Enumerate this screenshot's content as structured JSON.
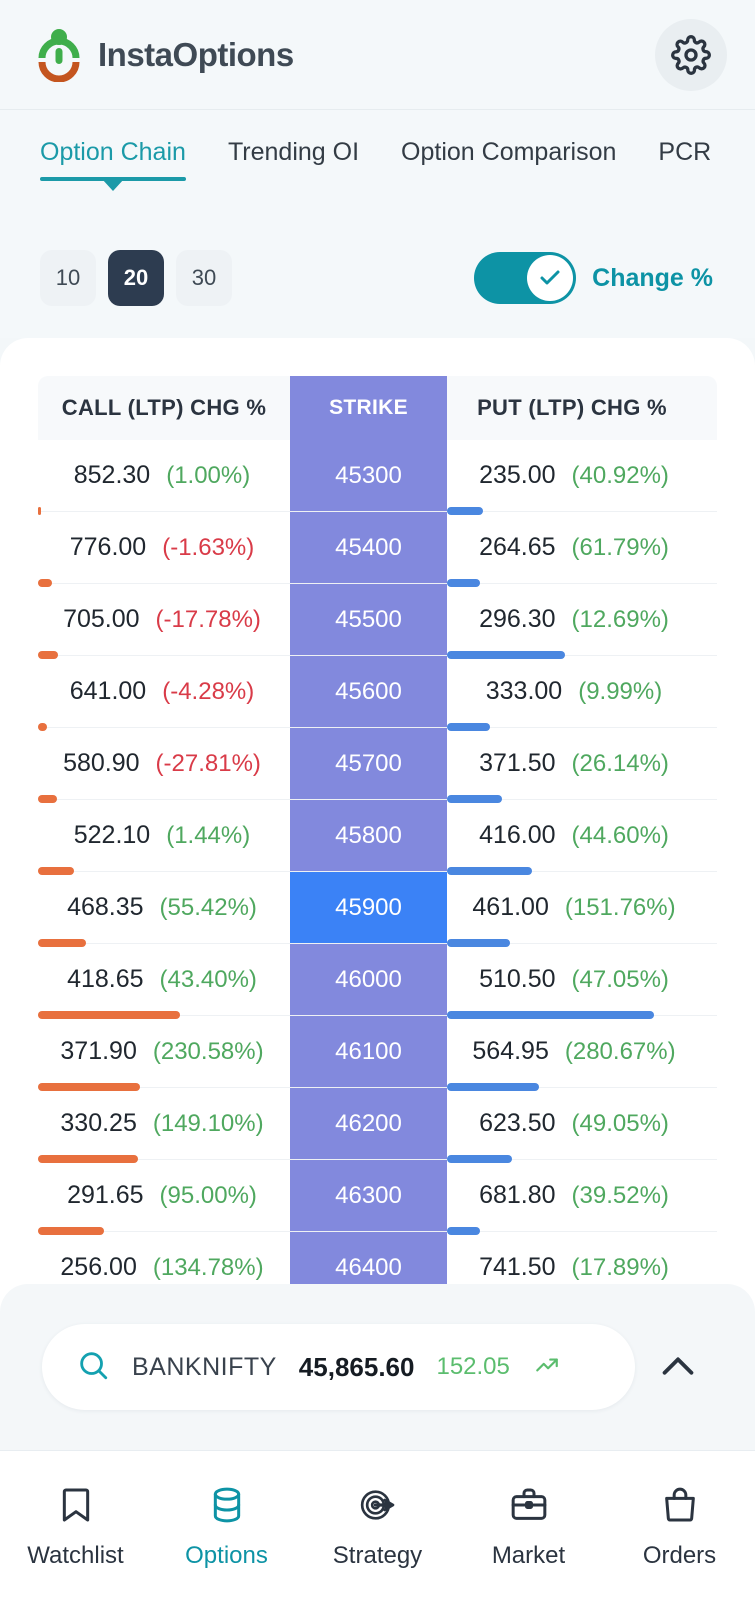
{
  "app": {
    "brand_name": "InstaOptions",
    "logo_icon": "instaoptions-logo",
    "settings_icon": "gear-icon"
  },
  "tabs": [
    {
      "label": "Option Chain",
      "active": true
    },
    {
      "label": "Trending OI",
      "active": false
    },
    {
      "label": "Option Comparison",
      "active": false
    },
    {
      "label": "PCR",
      "active": false
    }
  ],
  "controls": {
    "strike_counts": [
      {
        "label": "10",
        "active": false
      },
      {
        "label": "20",
        "active": true
      },
      {
        "label": "30",
        "active": false
      }
    ],
    "toggle": {
      "label": "Change %",
      "state": "on",
      "check_icon": "check-icon"
    }
  },
  "table": {
    "headers": {
      "call": "CALL (LTP) CHG %",
      "strike": "STRIKE",
      "put": "PUT (LTP) CHG %"
    },
    "rows": [
      {
        "call_ltp": "852.30",
        "call_chg": "(1.00%)",
        "call_dir": "up",
        "call_bar": 3,
        "strike": "45300",
        "atm": false,
        "put_ltp": "235.00",
        "put_chg": "(40.92%)",
        "put_dir": "up",
        "put_bar": 36
      },
      {
        "call_ltp": "776.00",
        "call_chg": "(-1.63%)",
        "call_dir": "down",
        "call_bar": 14,
        "strike": "45400",
        "atm": false,
        "put_ltp": "264.65",
        "put_chg": "(61.79%)",
        "put_dir": "up",
        "put_bar": 33
      },
      {
        "call_ltp": "705.00",
        "call_chg": "(-17.78%)",
        "call_dir": "down",
        "call_bar": 20,
        "strike": "45500",
        "atm": false,
        "put_ltp": "296.30",
        "put_chg": "(12.69%)",
        "put_dir": "up",
        "put_bar": 118
      },
      {
        "call_ltp": "641.00",
        "call_chg": "(-4.28%)",
        "call_dir": "down",
        "call_bar": 9,
        "strike": "45600",
        "atm": false,
        "put_ltp": "333.00",
        "put_chg": "(9.99%)",
        "put_dir": "up",
        "put_bar": 43
      },
      {
        "call_ltp": "580.90",
        "call_chg": "(-27.81%)",
        "call_dir": "down",
        "call_bar": 19,
        "strike": "45700",
        "atm": false,
        "put_ltp": "371.50",
        "put_chg": "(26.14%)",
        "put_dir": "up",
        "put_bar": 55
      },
      {
        "call_ltp": "522.10",
        "call_chg": "(1.44%)",
        "call_dir": "up",
        "call_bar": 36,
        "strike": "45800",
        "atm": false,
        "put_ltp": "416.00",
        "put_chg": "(44.60%)",
        "put_dir": "up",
        "put_bar": 85
      },
      {
        "call_ltp": "468.35",
        "call_chg": "(55.42%)",
        "call_dir": "up",
        "call_bar": 48,
        "strike": "45900",
        "atm": true,
        "put_ltp": "461.00",
        "put_chg": "(151.76%)",
        "put_dir": "up",
        "put_bar": 63
      },
      {
        "call_ltp": "418.65",
        "call_chg": "(43.40%)",
        "call_dir": "up",
        "call_bar": 142,
        "strike": "46000",
        "atm": false,
        "put_ltp": "510.50",
        "put_chg": "(47.05%)",
        "put_dir": "up",
        "put_bar": 207
      },
      {
        "call_ltp": "371.90",
        "call_chg": "(230.58%)",
        "call_dir": "up",
        "call_bar": 102,
        "strike": "46100",
        "atm": false,
        "put_ltp": "564.95",
        "put_chg": "(280.67%)",
        "put_dir": "up",
        "put_bar": 92
      },
      {
        "call_ltp": "330.25",
        "call_chg": "(149.10%)",
        "call_dir": "up",
        "call_bar": 100,
        "strike": "46200",
        "atm": false,
        "put_ltp": "623.50",
        "put_chg": "(49.05%)",
        "put_dir": "up",
        "put_bar": 65
      },
      {
        "call_ltp": "291.65",
        "call_chg": "(95.00%)",
        "call_dir": "up",
        "call_bar": 66,
        "strike": "46300",
        "atm": false,
        "put_ltp": "681.80",
        "put_chg": "(39.52%)",
        "put_dir": "up",
        "put_bar": 33
      },
      {
        "call_ltp": "256.00",
        "call_chg": "(134.78%)",
        "call_dir": "up",
        "call_bar": 60,
        "strike": "46400",
        "atm": false,
        "put_ltp": "741.50",
        "put_chg": "(17.89%)",
        "put_dir": "up",
        "put_bar": 19
      }
    ]
  },
  "search": {
    "search_icon": "search-icon",
    "symbol": "BANKNIFTY",
    "price": "45,865.60",
    "change": "152.05",
    "trend_icon": "trend-up-icon",
    "expand_icon": "chevron-up-icon"
  },
  "bottom_nav": [
    {
      "label": "Watchlist",
      "icon": "bookmark-icon",
      "active": false
    },
    {
      "label": "Options",
      "icon": "database-icon",
      "active": true
    },
    {
      "label": "Strategy",
      "icon": "target-icon",
      "active": false
    },
    {
      "label": "Market",
      "icon": "briefcase-icon",
      "active": false
    },
    {
      "label": "Orders",
      "icon": "shopping-bag-icon",
      "active": false
    }
  ],
  "colors": {
    "accent_teal": "#0d93a5",
    "strike_purple": "#8289dd",
    "atm_blue": "#3b82f6",
    "call_bar": "#e8703e",
    "put_bar": "#4a87e0",
    "up_green": "#4fa85f",
    "down_red": "#d93b48",
    "active_seg": "#2d3c50"
  }
}
